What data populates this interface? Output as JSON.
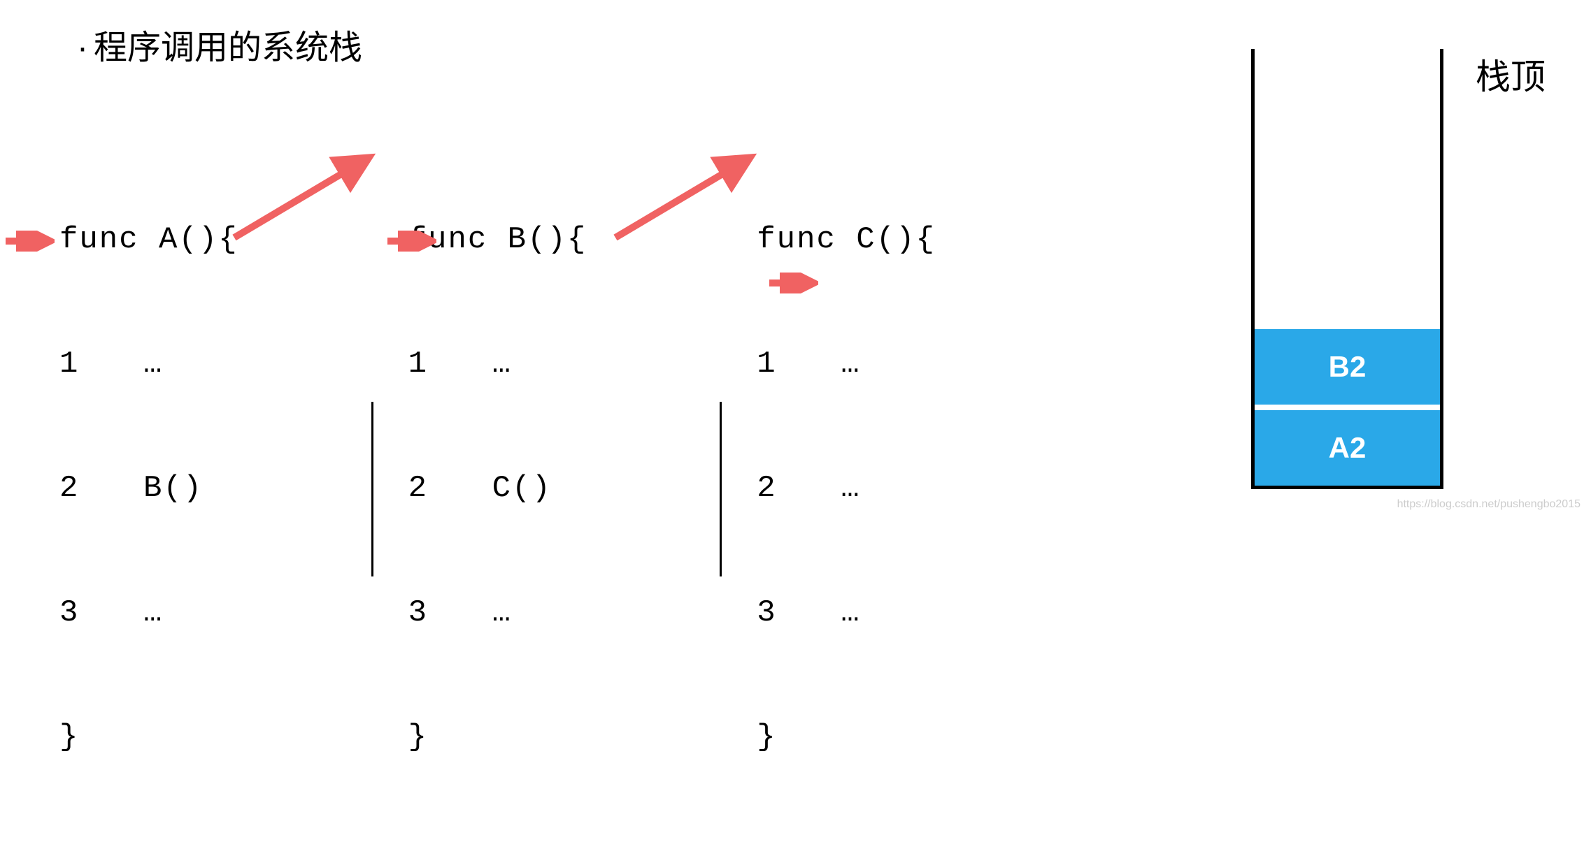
{
  "title_bullet": "·",
  "title_text": "程序调用的系统栈",
  "funcs": [
    {
      "header": "func A(){",
      "line1_num": "1",
      "line1_body": "…",
      "line2_num": "2",
      "line2_body": "B()",
      "line3_num": "3",
      "line3_body": "…",
      "footer": "}"
    },
    {
      "header": "func B(){",
      "line1_num": "1",
      "line1_body": "…",
      "line2_num": "2",
      "line2_body": "C()",
      "line3_num": "3",
      "line3_body": "…",
      "footer": "}"
    },
    {
      "header": "func C(){",
      "line1_num": "1",
      "line1_body": "…",
      "line2_num": "2",
      "line2_body": "…",
      "line3_num": "3",
      "line3_body": "…",
      "footer": "}"
    }
  ],
  "stack": {
    "top_label": "栈顶",
    "items": [
      "B2",
      "A2"
    ]
  },
  "arrow_color": "#F06262",
  "stack_color": "#2AA8E8",
  "watermark": "https://blog.csdn.net/pushengbo2015"
}
